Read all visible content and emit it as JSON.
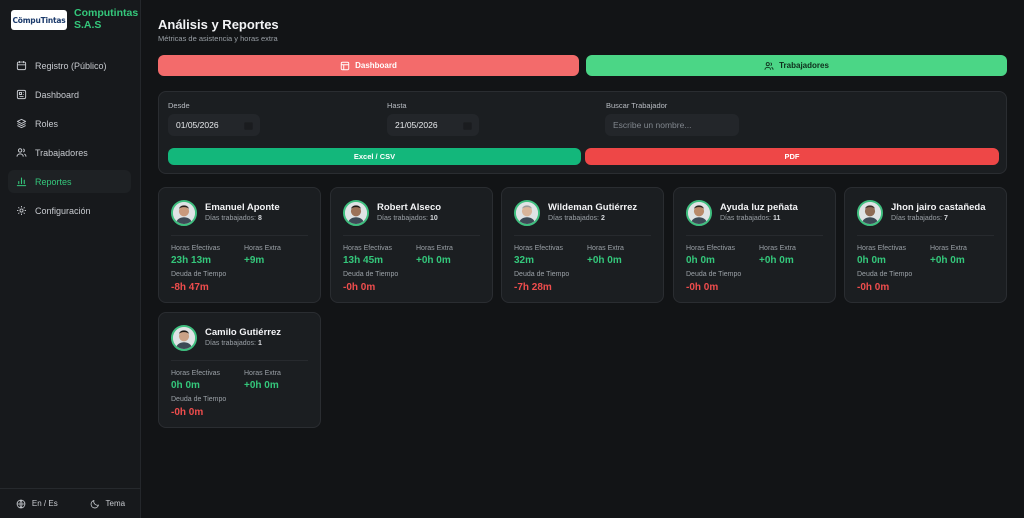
{
  "brand": {
    "logo_text": "CömpuTintas",
    "name": "Computintas S.A.S"
  },
  "nav": [
    {
      "label": "Registro (Público)",
      "icon": "calendar-icon"
    },
    {
      "label": "Dashboard",
      "icon": "dashboard-icon"
    },
    {
      "label": "Roles",
      "icon": "layers-icon"
    },
    {
      "label": "Trabajadores",
      "icon": "users-icon"
    },
    {
      "label": "Reportes",
      "icon": "bar-chart-icon",
      "active": true
    },
    {
      "label": "Configuración",
      "icon": "gear-icon"
    }
  ],
  "footer": {
    "language": "En / Es",
    "theme": "Tema"
  },
  "header": {
    "title": "Análisis y Reportes",
    "subtitle": "Métricas de asistencia y horas extra"
  },
  "tabs": {
    "dashboard": "Dashboard",
    "workers": "Trabajadores"
  },
  "filters": {
    "from_label": "Desde",
    "from_value": "01/05/2026",
    "to_label": "Hasta",
    "to_value": "21/05/2026",
    "search_label": "Buscar Trabajador",
    "search_placeholder": "Escribe un nombre..."
  },
  "export": {
    "excel": "Excel / CSV",
    "pdf": "PDF"
  },
  "labels": {
    "days": "Días trabajados:",
    "effective": "Horas Efectivas",
    "extra": "Horas Extra",
    "debt": "Deuda de Tiempo"
  },
  "workers": [
    {
      "name": "Emanuel Aponte",
      "days": "8",
      "effective": "23h 13m",
      "extra": "+9m",
      "debt": "-8h 47m"
    },
    {
      "name": "Robert Alseco",
      "days": "10",
      "effective": "13h 45m",
      "extra": "+0h 0m",
      "debt": "-0h 0m"
    },
    {
      "name": "Wildeman Gutiérrez",
      "days": "2",
      "effective": "32m",
      "extra": "+0h 0m",
      "debt": "-7h 28m"
    },
    {
      "name": "Ayuda luz peñata",
      "days": "11",
      "effective": "0h 0m",
      "extra": "+0h 0m",
      "debt": "-0h 0m"
    },
    {
      "name": "Jhon jairo castañeda",
      "days": "7",
      "effective": "0h 0m",
      "extra": "+0h 0m",
      "debt": "-0h 0m"
    },
    {
      "name": "Camilo Gutiérrez",
      "days": "1",
      "effective": "0h 0m",
      "extra": "+0h 0m",
      "debt": "-0h 0m"
    }
  ],
  "colors": {
    "accent_green": "#34c77b",
    "danger_red": "#ef4d4d",
    "background": "#121416"
  }
}
